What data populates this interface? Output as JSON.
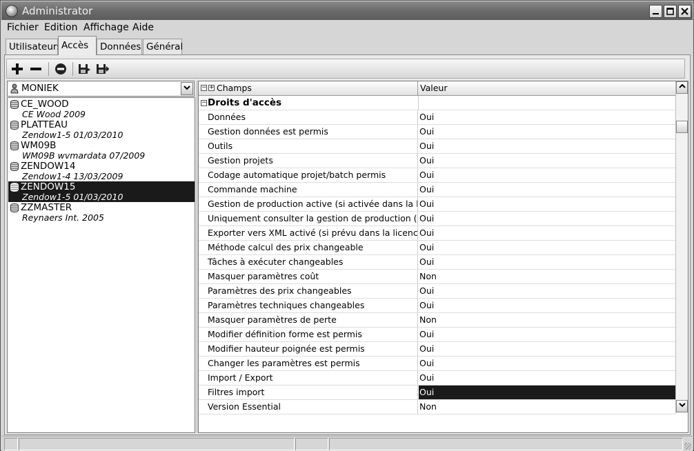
{
  "window": {
    "title": "Administrator"
  },
  "menu": [
    "Fichier",
    "Edition",
    "Affichage",
    "Aide"
  ],
  "tabs": [
    {
      "label": "Utilisateurs",
      "active": false
    },
    {
      "label": "Accès",
      "active": true
    },
    {
      "label": "Données",
      "active": false
    },
    {
      "label": "Général",
      "active": false
    }
  ],
  "toolbar": {
    "icons": [
      "plus-icon",
      "minus-icon",
      "remove-circle-icon",
      "save-icon",
      "save-as-icon"
    ]
  },
  "user_select": {
    "value": "MONIEK"
  },
  "databases": [
    {
      "name": "CE_WOOD",
      "desc": "CE Wood 2009",
      "selected": false
    },
    {
      "name": "PLATTEAU",
      "desc": "Zendow1-5 01/03/2010",
      "selected": false
    },
    {
      "name": "WM09B",
      "desc": "WM09B wvmardata 07/2009",
      "selected": false
    },
    {
      "name": "ZENDOW14",
      "desc": "Zendow1-4 13/03/2009",
      "selected": false
    },
    {
      "name": "ZENDOW15",
      "desc": "Zendow1-5 01/03/2010",
      "selected": true
    },
    {
      "name": "ZZMASTER",
      "desc": "Reynaers Int. 2005",
      "selected": false
    }
  ],
  "grid": {
    "headers": {
      "name": "Champs",
      "value": "Valeur"
    },
    "category": "Droits d'accès",
    "rows": [
      {
        "name": "Données",
        "value": "Oui",
        "selected": false
      },
      {
        "name": "Gestion données est permis",
        "value": "Oui",
        "selected": false
      },
      {
        "name": "Outils",
        "value": "Oui",
        "selected": false
      },
      {
        "name": "Gestion projets",
        "value": "Oui",
        "selected": false
      },
      {
        "name": "Codage automatique projet/batch permis",
        "value": "Oui",
        "selected": false
      },
      {
        "name": "Commande machine",
        "value": "Oui",
        "selected": false
      },
      {
        "name": "Gestion de production active (si activée dans la licence)",
        "value": "Oui",
        "selected": false
      },
      {
        "name": "Uniquement consulter la gestion de production (si activée)",
        "value": "Oui",
        "selected": false
      },
      {
        "name": "Exporter vers XML activé (si prévu dans la licence)",
        "value": "Oui",
        "selected": false
      },
      {
        "name": "Méthode calcul des prix changeable",
        "value": "Oui",
        "selected": false
      },
      {
        "name": "Tâches à exécuter changeables",
        "value": "Oui",
        "selected": false
      },
      {
        "name": "Masquer paramètres coût",
        "value": "Non",
        "selected": false
      },
      {
        "name": "Paramètres des prix changeables",
        "value": "Oui",
        "selected": false
      },
      {
        "name": "Paramètres techniques changeables",
        "value": "Oui",
        "selected": false
      },
      {
        "name": "Masquer paramètres de perte",
        "value": "Non",
        "selected": false
      },
      {
        "name": "Modifier définition forme est permis",
        "value": "Oui",
        "selected": false
      },
      {
        "name": "Modifier hauteur poignée est permis",
        "value": "Oui",
        "selected": false
      },
      {
        "name": "Changer les paramètres est permis",
        "value": "Oui",
        "selected": false
      },
      {
        "name": "Import / Export",
        "value": "Oui",
        "selected": false
      },
      {
        "name": "Filtres import",
        "value": "Oui",
        "selected": true
      },
      {
        "name": "Version Essential",
        "value": "Non",
        "selected": false
      }
    ]
  }
}
